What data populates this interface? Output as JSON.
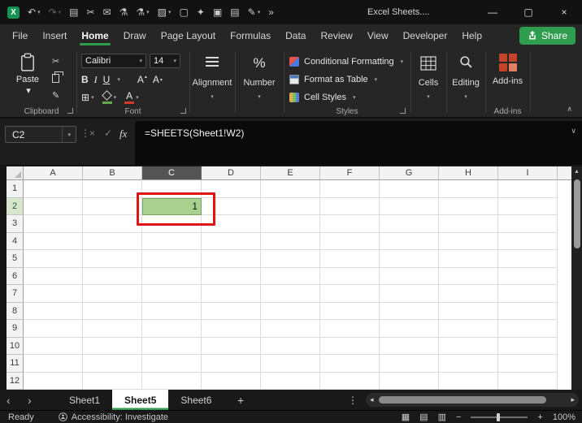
{
  "titlebar": {
    "title": "Excel Sheets....",
    "qat_icons": [
      {
        "name": "excel-logo",
        "glyph": "X"
      },
      {
        "name": "undo",
        "glyph": "↶",
        "chevron": true
      },
      {
        "name": "redo",
        "glyph": "↷",
        "chevron": true,
        "dim": true
      },
      {
        "name": "clipboard-history",
        "glyph": "▤"
      },
      {
        "name": "cut",
        "glyph": "✂"
      },
      {
        "name": "mail",
        "glyph": "✉"
      },
      {
        "name": "flask",
        "glyph": "⚗"
      },
      {
        "name": "beaker",
        "glyph": "⚗",
        "chevron": true
      },
      {
        "name": "format-painter",
        "glyph": "▨",
        "chevron": true
      },
      {
        "name": "new-document",
        "glyph": "▢"
      },
      {
        "name": "sparkle",
        "glyph": "✦"
      },
      {
        "name": "camera",
        "glyph": "▣"
      },
      {
        "name": "notebook",
        "glyph": "▤"
      },
      {
        "name": "draw-pen",
        "glyph": "✎",
        "chevron": true
      },
      {
        "name": "more-commands",
        "glyph": "»"
      }
    ],
    "window_controls": [
      {
        "name": "minimize",
        "glyph": "—"
      },
      {
        "name": "maximize",
        "glyph": "▢"
      },
      {
        "name": "close",
        "glyph": "×"
      }
    ]
  },
  "menu": {
    "tabs": [
      "File",
      "Insert",
      "Home",
      "Draw",
      "Page Layout",
      "Formulas",
      "Data",
      "Review",
      "View",
      "Developer",
      "Help"
    ],
    "active_tab": "Home",
    "share_label": "Share"
  },
  "ribbon": {
    "clipboard": {
      "paste_label": "Paste",
      "group_label": "Clipboard"
    },
    "font": {
      "family": "Calibri",
      "size": "14",
      "bold_label": "B",
      "italic_label": "I",
      "underline_label": "U",
      "letter_label": "A",
      "group_label": "Font"
    },
    "alignment": {
      "label": "Alignment"
    },
    "number": {
      "percent": "%",
      "label": "Number"
    },
    "styles": {
      "items": [
        "Conditional Formatting",
        "Format as Table",
        "Cell Styles"
      ],
      "group_label": "Styles"
    },
    "cells": {
      "label": "Cells"
    },
    "editing": {
      "label": "Editing"
    },
    "addins": {
      "button_label": "Add-ins",
      "group_label": "Add-ins"
    }
  },
  "formula_bar": {
    "name_box": "C2",
    "formula": "=SHEETS(Sheet1!W2)",
    "fx_label": "fx"
  },
  "grid": {
    "columns": [
      "A",
      "B",
      "C",
      "D",
      "E",
      "F",
      "G",
      "H",
      "I"
    ],
    "rows": [
      "1",
      "2",
      "3",
      "4",
      "5",
      "6",
      "7",
      "8",
      "9",
      "10",
      "11",
      "12"
    ],
    "selected_column": "C",
    "selected_row": "2",
    "active_cell": {
      "column": "C",
      "row": "2",
      "value": "1"
    },
    "annotation_target": "C2"
  },
  "sheet_bar": {
    "tabs": [
      "Sheet1",
      "Sheet5",
      "Sheet6"
    ],
    "active_tab": "Sheet5",
    "add_label": "+"
  },
  "status_bar": {
    "ready_label": "Ready",
    "accessibility_label": "Accessibility: Investigate",
    "zoom_value": "100%"
  },
  "icons": {
    "chevron_down": "▾",
    "chevron_up": "∧",
    "expand_down": "∨",
    "ellipsis_v": "⋮",
    "cut": "✂",
    "format_painter": "✎",
    "borders": "⊞",
    "tri_up": "▴",
    "tri_down": "▾",
    "scrollbar_up": "▲",
    "nav_left": "‹",
    "nav_right": "›",
    "scroll_left": "◂",
    "scroll_right": "▸",
    "view_normal": "▦",
    "view_layout": "▤",
    "view_break": "▥",
    "zoom_out": "−",
    "zoom_in": "+",
    "cancel": "×",
    "enter": "✓"
  },
  "colors": {
    "accent_green": "#2e9e4e",
    "cell_fill_green": "#a9d08e",
    "annotation_red": "#e01414",
    "addins_red": "#c4432b",
    "fill_swatch_green": "#6aa84f",
    "font_color_red": "#d3392b"
  }
}
